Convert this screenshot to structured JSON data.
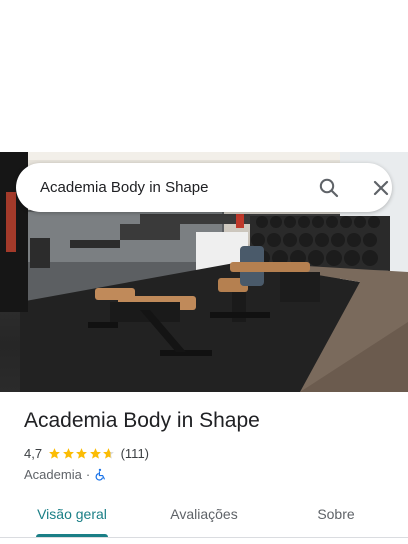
{
  "search": {
    "query": "Academia Body in Shape",
    "search_icon": "search-icon",
    "close_icon": "close-icon"
  },
  "place": {
    "name": "Academia Body in Shape",
    "rating": "4,7",
    "rating_fraction": 0.94,
    "review_count": "(111)",
    "category": "Academia",
    "separator": "·",
    "accessibility_icon": "wheelchair-icon"
  },
  "tabs": [
    {
      "label": "Visão geral",
      "active": true
    },
    {
      "label": "Avaliações",
      "active": false
    },
    {
      "label": "Sobre",
      "active": false
    }
  ],
  "colors": {
    "accent": "#1a7f86",
    "star": "#fbbc04",
    "wheelchair": "#1a73e8"
  },
  "photo": {
    "description_icon": "gym-photo"
  }
}
